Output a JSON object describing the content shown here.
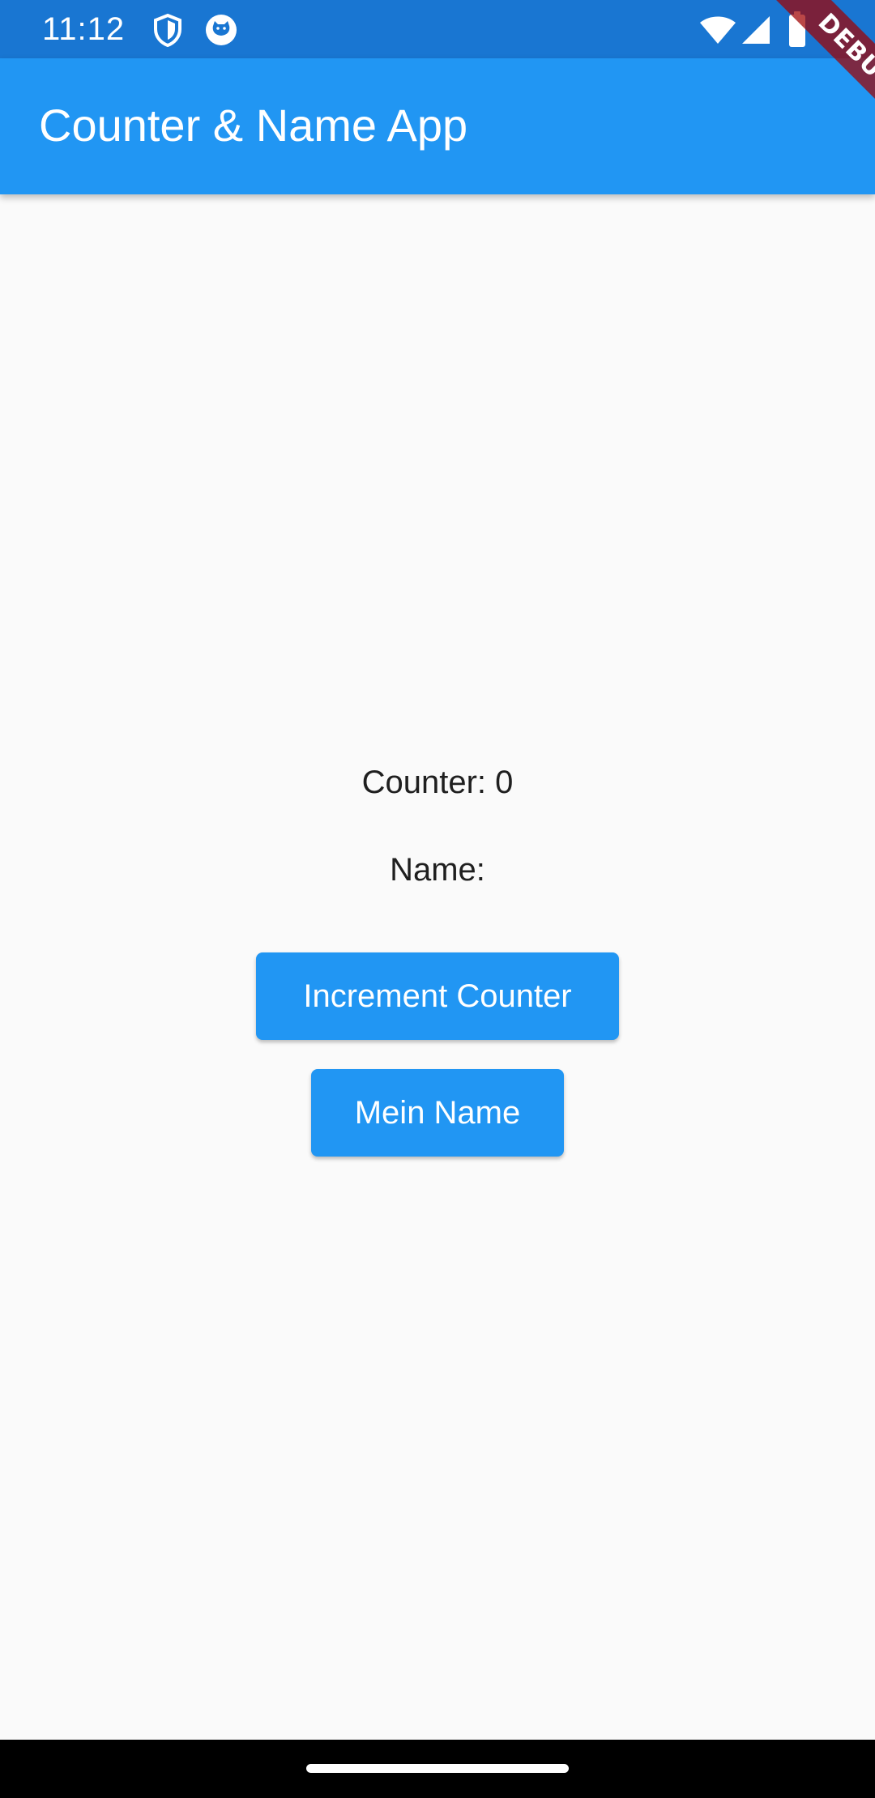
{
  "status_bar": {
    "time": "11:12",
    "icons": [
      "shield-icon",
      "cat-icon",
      "wifi-icon",
      "signal-icon",
      "battery-icon"
    ],
    "background": "#1976d2"
  },
  "app_bar": {
    "title": "Counter & Name App",
    "background": "#2196f3"
  },
  "debug_banner": {
    "label": "DEBUG"
  },
  "main": {
    "counter_text": "Counter: 0",
    "name_text": "Name:",
    "increment_button_label": "Increment Counter",
    "name_button_label": "Mein Name",
    "button_color": "#2196f3"
  },
  "nav_bar": {
    "background": "#000000"
  }
}
